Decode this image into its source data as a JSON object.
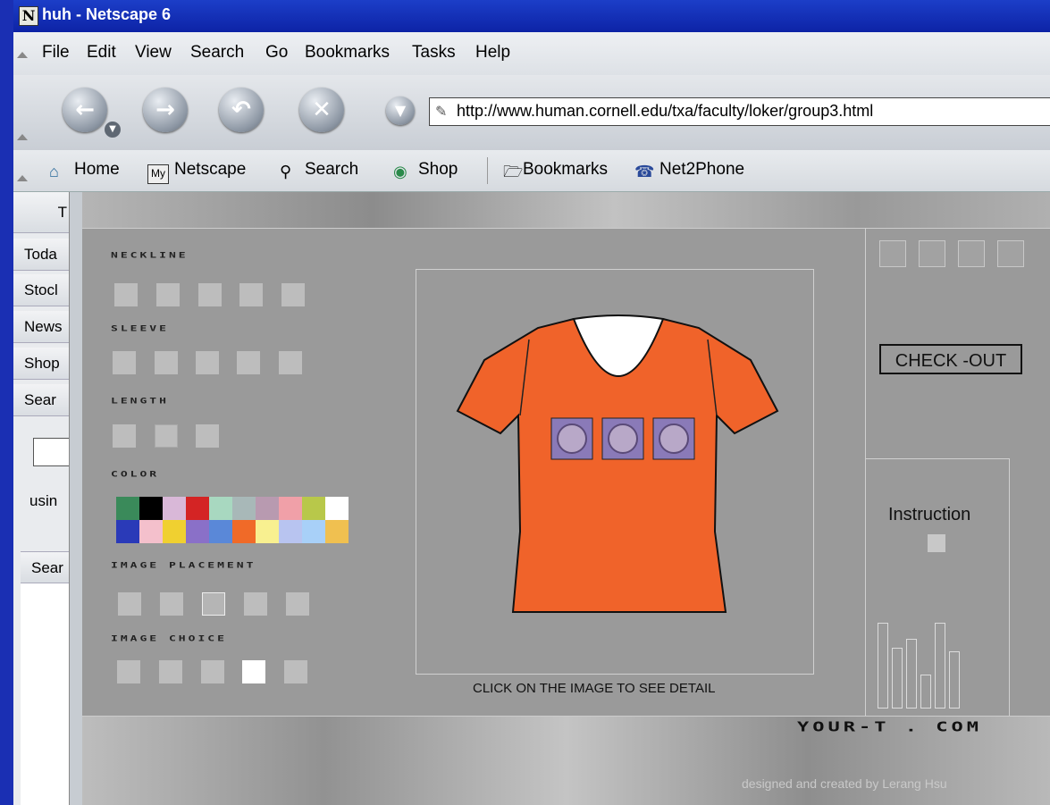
{
  "window": {
    "title": "huh - Netscape 6",
    "logo_letter": "N"
  },
  "menu": [
    "File",
    "Edit",
    "View",
    "Search",
    "Go",
    "Bookmarks",
    "Tasks",
    "Help"
  ],
  "nav": {
    "url": "http://www.human.cornell.edu/txa/faculty/loker/group3.html"
  },
  "personal_toolbar": [
    "Home",
    "Netscape",
    "Search",
    "Shop",
    "Bookmarks",
    "Net2Phone"
  ],
  "personal_my_badge": "My",
  "sidebar": {
    "header": "T",
    "tabs": [
      "Toda",
      "Stocl",
      "News",
      "Shop",
      "Sear"
    ],
    "search_caption": "usin",
    "search_tab": "Sear"
  },
  "designer": {
    "sections": {
      "neckline": "NECKLINE",
      "sleeve": "SLEEVE",
      "length": "LENGTH",
      "color": "COLOR",
      "image_placement": "IMAGE PLACEMENT",
      "image_choice": "IMAGE CHOICE"
    },
    "palette_top": [
      "#3a8a5a",
      "#000000",
      "#d9b8d8",
      "#d42424",
      "#a8d8c0",
      "#a8b8b8",
      "#b89ab0",
      "#f0a0a8",
      "#b8c84a",
      "#ffffff"
    ],
    "palette_bottom": [
      "#2a3ab8",
      "#f4c0cc",
      "#f0d030",
      "#8a70c8",
      "#5a88d8",
      "#f06a28",
      "#f8f090",
      "#b8c4f0",
      "#a8d0f8",
      "#f0c050"
    ],
    "shirt_color": "#f0632a",
    "detail_caption": "CLICK ON THE IMAGE TO SEE DETAIL",
    "checkout_label": "CHECK -OUT",
    "instruction_label": "Instruction",
    "brand": "YOUR-T . COM",
    "credit": "designed and created by Lerang Hsu"
  }
}
